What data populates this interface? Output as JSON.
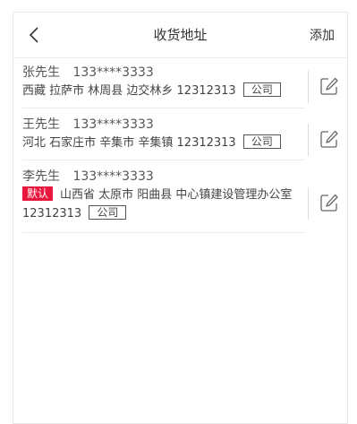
{
  "header": {
    "title": "收货地址",
    "add_label": "添加"
  },
  "addresses": [
    {
      "name": "张先生",
      "phone": "133****3333",
      "address": "西藏 拉萨市 林周县 边交林乡 12312313",
      "tag": "公司",
      "is_default": false
    },
    {
      "name": "王先生",
      "phone": "133****3333",
      "address": "河北 石家庄市 辛集市 辛集镇 12312313",
      "tag": "公司",
      "is_default": false
    },
    {
      "name": "李先生",
      "phone": "133****3333",
      "default_label": "默认",
      "address_line1": "山西省 太原市 阳曲县 中心镇建设管理办公室",
      "address_line2": "12312313",
      "tag": "公司",
      "is_default": true
    }
  ],
  "icons": {
    "back": "chevron-left-icon",
    "edit": "edit-icon"
  },
  "colors": {
    "default_badge": "#e8173d"
  }
}
